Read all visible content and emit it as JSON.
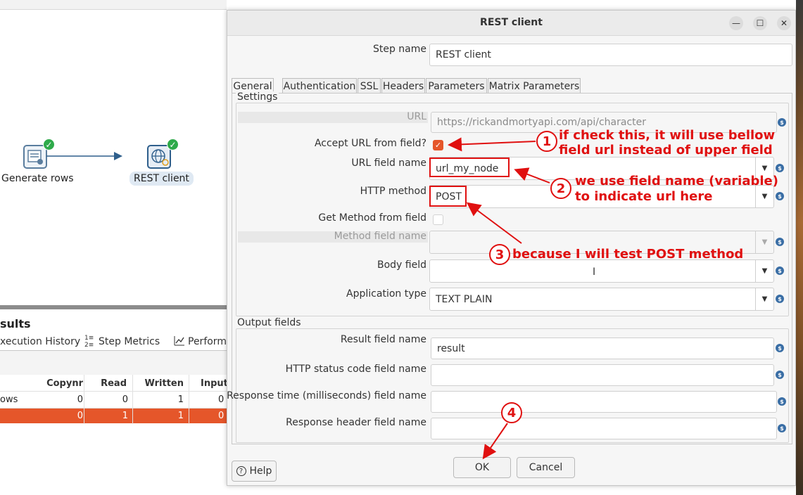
{
  "canvas": {
    "nodes": [
      {
        "label": "Generate rows",
        "icon": "generate-rows-icon"
      },
      {
        "label": "REST client",
        "icon": "rest-client-icon"
      }
    ]
  },
  "results": {
    "title_fragment": "sults",
    "tabs": [
      {
        "label": "xecution History"
      },
      {
        "label": "Step Metrics"
      },
      {
        "label": "Perform"
      }
    ],
    "columns": [
      "Copynr",
      "Read",
      "Written",
      "Input"
    ],
    "rows": [
      {
        "name": "ows",
        "copynr": "0",
        "read": "0",
        "written": "1",
        "input": "0"
      },
      {
        "name": "",
        "copynr": "0",
        "read": "1",
        "written": "1",
        "input": "0"
      }
    ]
  },
  "dialog": {
    "title": "REST client",
    "step_name_label": "Step name",
    "step_name_value": "REST client",
    "tabs": [
      "General",
      "Authentication",
      "SSL",
      "Headers",
      "Parameters",
      "Matrix Parameters"
    ],
    "settings": {
      "group_title": "Settings",
      "url_label": "URL",
      "url_value": "https://rickandmortyapi.com/api/character",
      "accept_url_label": "Accept URL from field?",
      "accept_url_checked": true,
      "url_field_label": "URL field name",
      "url_field_value": "url_my_node",
      "http_method_label": "HTTP method",
      "http_method_value": "POST",
      "get_method_label": "Get Method from field",
      "get_method_checked": false,
      "method_field_label": "Method field name",
      "method_field_value": "",
      "body_field_label": "Body field",
      "body_field_value": "",
      "app_type_label": "Application type",
      "app_type_value": "TEXT PLAIN"
    },
    "output": {
      "group_title": "Output fields",
      "result_label": "Result field name",
      "result_value": "result",
      "status_label": "HTTP status code field name",
      "status_value": "",
      "response_time_label": "Response time (milliseconds) field name",
      "response_time_value": "",
      "response_header_label": "Response header field name",
      "response_header_value": ""
    },
    "buttons": {
      "help": "Help",
      "ok": "OK",
      "cancel": "Cancel"
    }
  },
  "annotations": [
    {
      "number": "1",
      "line1": "if check this, it will use bellow",
      "line2": "field url instead of upper field"
    },
    {
      "number": "2",
      "line1": "we use field name (variable)",
      "line2": "to indicate url here"
    },
    {
      "number": "3",
      "line1": "because I will test POST method"
    },
    {
      "number": "4"
    }
  ],
  "colors": {
    "annotation_red": "#e01010",
    "accent_orange": "#e5562a",
    "success_green": "#2eaa4a"
  }
}
